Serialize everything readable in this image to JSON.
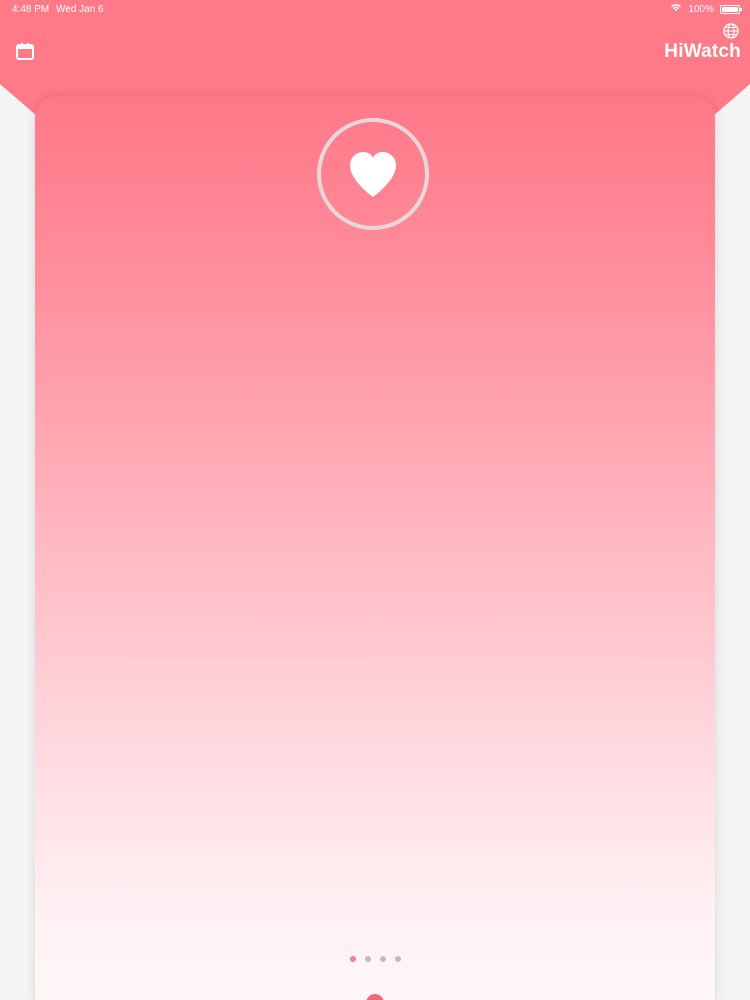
{
  "status": {
    "time": "4:48 PM",
    "date": "Wed Jan 6",
    "battery_text": "100%"
  },
  "header": {
    "title": "HiWatch"
  },
  "icons": {
    "calendar": "calendar-icon",
    "globe": "globe-icon",
    "wifi": "wifi-icon",
    "battery": "battery-icon",
    "heart": "heart-icon"
  },
  "pagination": {
    "count": 4,
    "active_index": 0
  },
  "colors": {
    "accent": "#ff7a88",
    "active_dot": "#ef7f8e",
    "inactive_dot": "#bdbdbd"
  }
}
